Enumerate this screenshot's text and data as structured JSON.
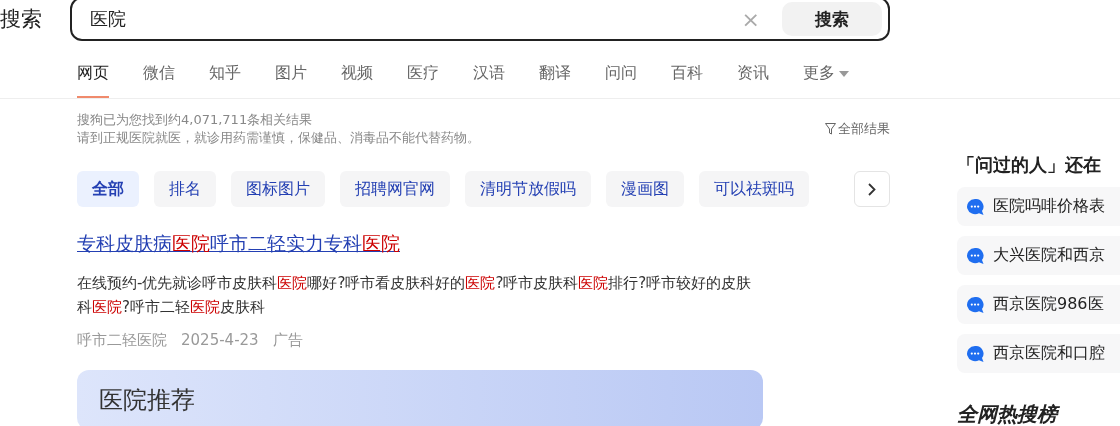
{
  "search": {
    "label": "搜索",
    "value": "医院",
    "clear": "×",
    "button": "搜索"
  },
  "tabs": [
    {
      "label": "网页",
      "selected": true
    },
    {
      "label": "微信",
      "selected": false
    },
    {
      "label": "知乎",
      "selected": false
    },
    {
      "label": "图片",
      "selected": false
    },
    {
      "label": "视频",
      "selected": false
    },
    {
      "label": "医疗",
      "selected": false
    },
    {
      "label": "汉语",
      "selected": false
    },
    {
      "label": "翻译",
      "selected": false
    },
    {
      "label": "问问",
      "selected": false
    },
    {
      "label": "百科",
      "selected": false
    },
    {
      "label": "资讯",
      "selected": false
    },
    {
      "label": "更多",
      "selected": false,
      "kind": "dropdown"
    }
  ],
  "result_info": {
    "count": "搜狗已为您找到约4,071,711条相关结果",
    "notice": "请到正规医院就医，就诊用药需谨慎，保健品、消毒品不能代替药物。",
    "filter": "全部结果"
  },
  "chips": [
    {
      "label": "全部",
      "selected": true
    },
    {
      "label": "排名",
      "selected": false
    },
    {
      "label": "图标图片",
      "selected": false
    },
    {
      "label": "招聘网官网",
      "selected": false
    },
    {
      "label": "清明节放假吗",
      "selected": false
    },
    {
      "label": "漫画图",
      "selected": false
    },
    {
      "label": "可以祛斑吗",
      "selected": false
    }
  ],
  "result": {
    "title": [
      {
        "text": "专科皮肤病",
        "highlight": false
      },
      {
        "text": "医院",
        "highlight": true
      },
      {
        "text": "呼市二轻实力专科",
        "highlight": false
      },
      {
        "text": "医院",
        "highlight": true
      }
    ],
    "description": [
      {
        "text": "在线预约-优先就诊呼市皮肤科",
        "highlight": false
      },
      {
        "text": "医院",
        "highlight": true
      },
      {
        "text": "哪好?呼市看皮肤科好的",
        "highlight": false
      },
      {
        "text": "医院",
        "highlight": true
      },
      {
        "text": "?呼市皮肤科",
        "highlight": false
      },
      {
        "text": "医院",
        "highlight": true
      },
      {
        "text": "排行?呼市较好的皮肤科",
        "highlight": false
      },
      {
        "text": "医院",
        "highlight": true
      },
      {
        "text": "?呼市二轻",
        "highlight": false
      },
      {
        "text": "医院",
        "highlight": true
      },
      {
        "text": "皮肤科",
        "highlight": false
      }
    ],
    "source": "呼市二轻医院",
    "date": "2025-4-23",
    "ad": "广告"
  },
  "card": {
    "title": "医院推荐"
  },
  "sidebar": {
    "heading": "「问过的人」还在",
    "questions": [
      "医院吗啡价格表",
      "大兴医院和西京",
      "西京医院986医",
      "西京医院和口腔"
    ],
    "hot_title": "全网热搜榜"
  }
}
